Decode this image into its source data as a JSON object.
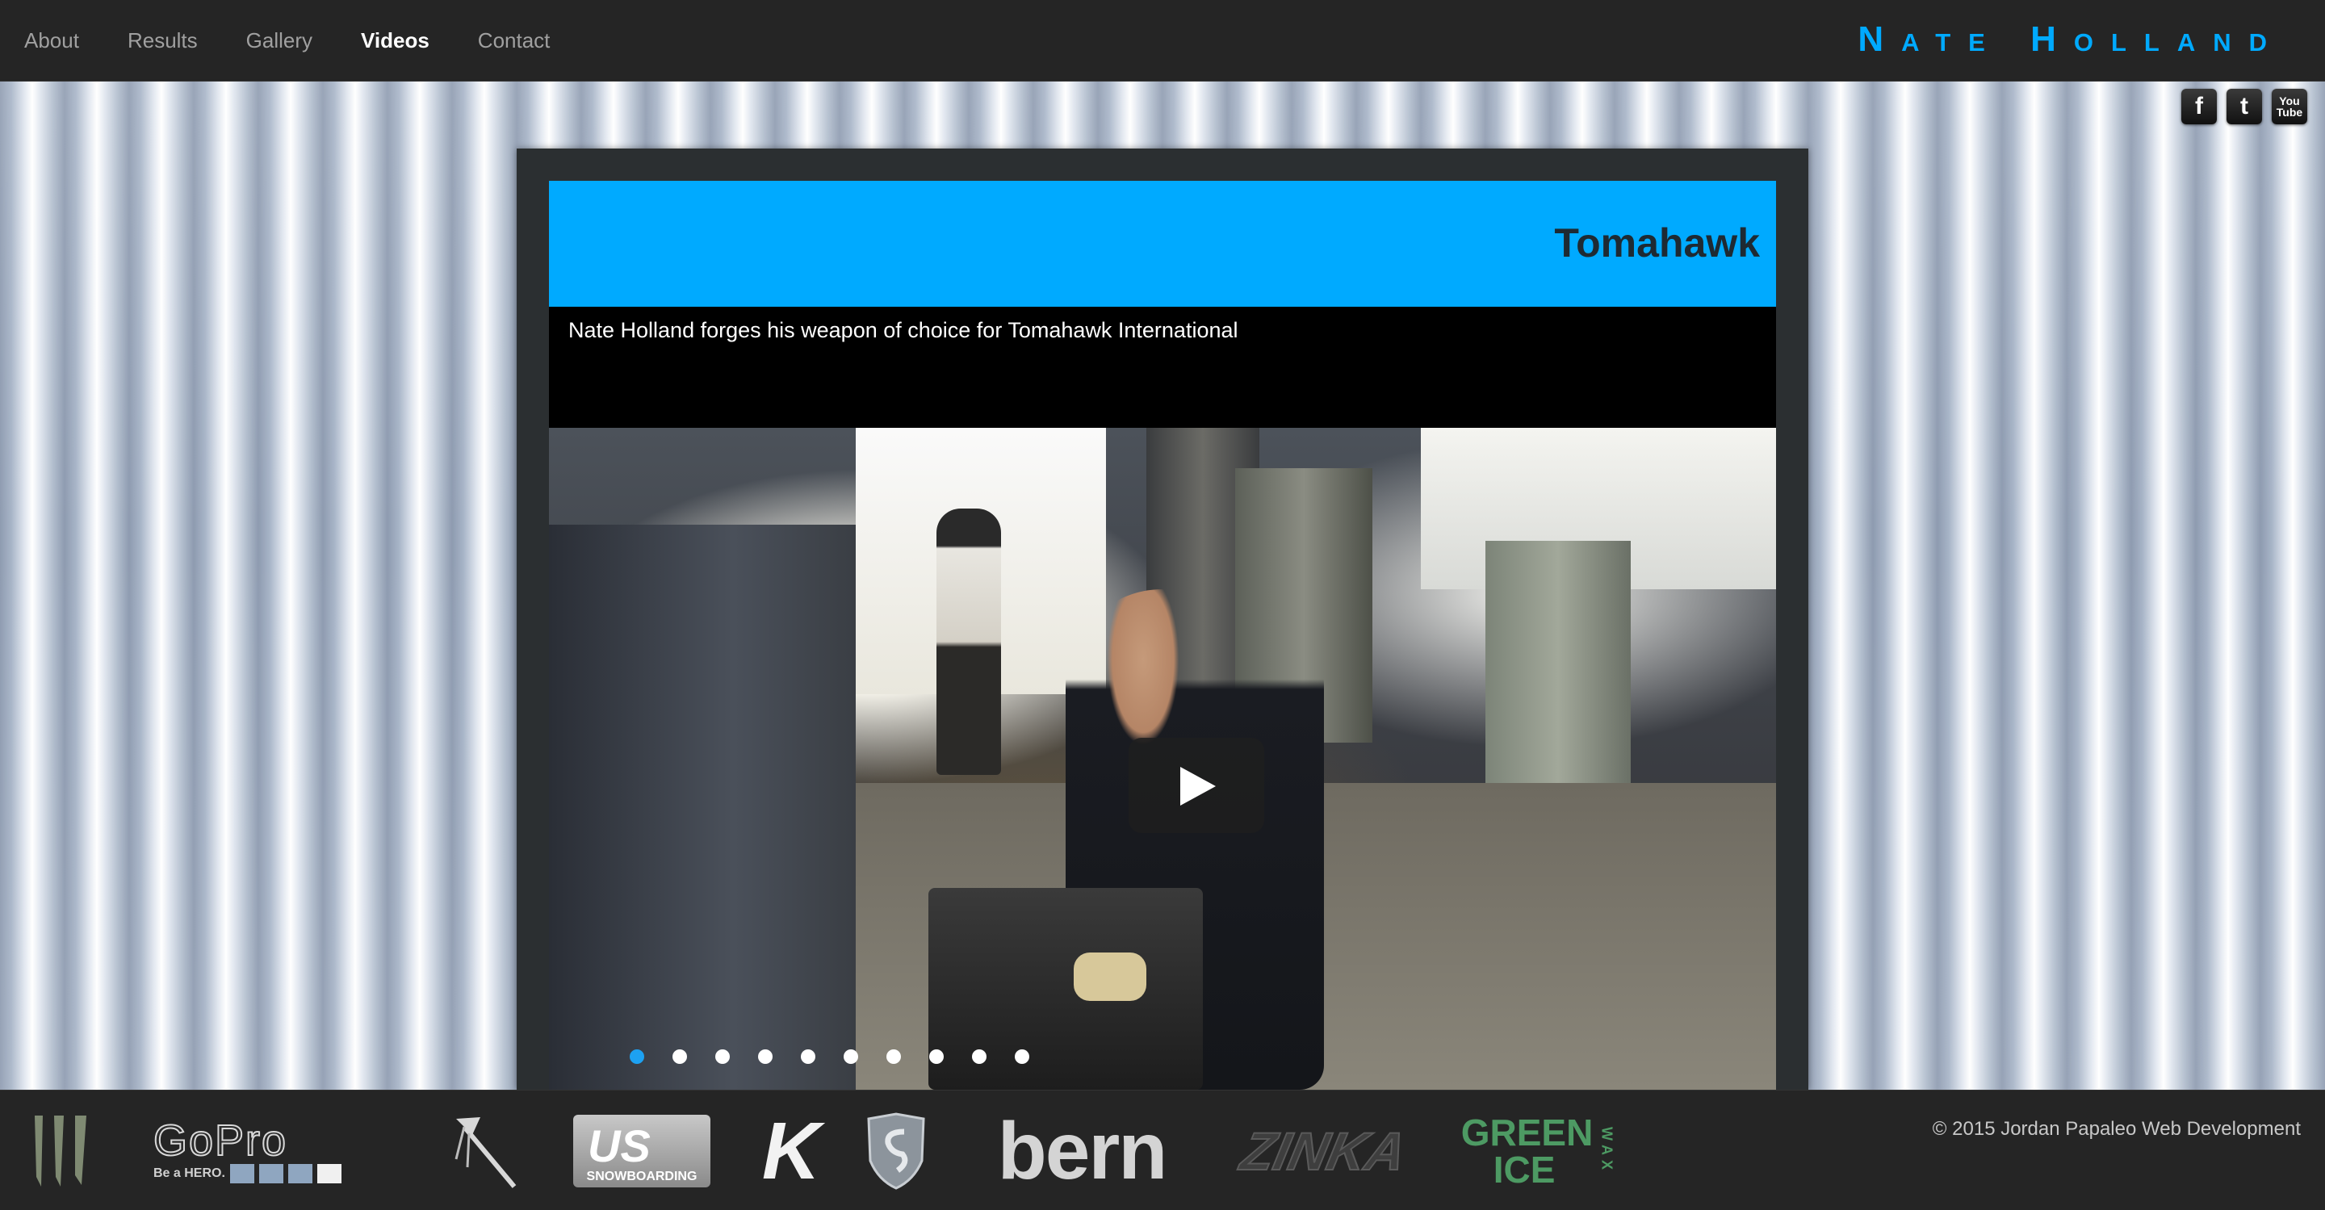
{
  "nav": {
    "items": [
      {
        "label": "About",
        "active": false
      },
      {
        "label": "Results",
        "active": false
      },
      {
        "label": "Gallery",
        "active": false
      },
      {
        "label": "Videos",
        "active": true
      },
      {
        "label": "Contact",
        "active": false
      }
    ],
    "brand": "Nate Holland"
  },
  "social": {
    "facebook": "f",
    "twitter": "t",
    "youtube_top": "You",
    "youtube_bottom": "Tube"
  },
  "video_panel": {
    "title": "Tomahawk",
    "description": "Nate Holland forges his weapon of choice for Tomahawk International",
    "slide_count": 10,
    "active_slide": 1,
    "title_bar_color": "#00aaff"
  },
  "footer": {
    "copyright": "© 2015 Jordan Papaleo Web Development",
    "sponsors": [
      {
        "name": "monster-logo",
        "text": ""
      },
      {
        "name": "gopro-logo",
        "text": "GoPro",
        "subtext": "Be a HERO."
      },
      {
        "name": "tomahawk-logo",
        "text": ""
      },
      {
        "name": "us-snowboarding-logo",
        "text": "SNOWBOARDING"
      },
      {
        "name": "k-logo",
        "text": "K"
      },
      {
        "name": "shield-logo",
        "text": ""
      },
      {
        "name": "bern-logo",
        "text": "bern"
      },
      {
        "name": "zinka-logo",
        "text": "ZINKA"
      },
      {
        "name": "green-ice-logo",
        "text": "GREEN",
        "text2": "ICE",
        "text3": "WAX"
      }
    ]
  }
}
